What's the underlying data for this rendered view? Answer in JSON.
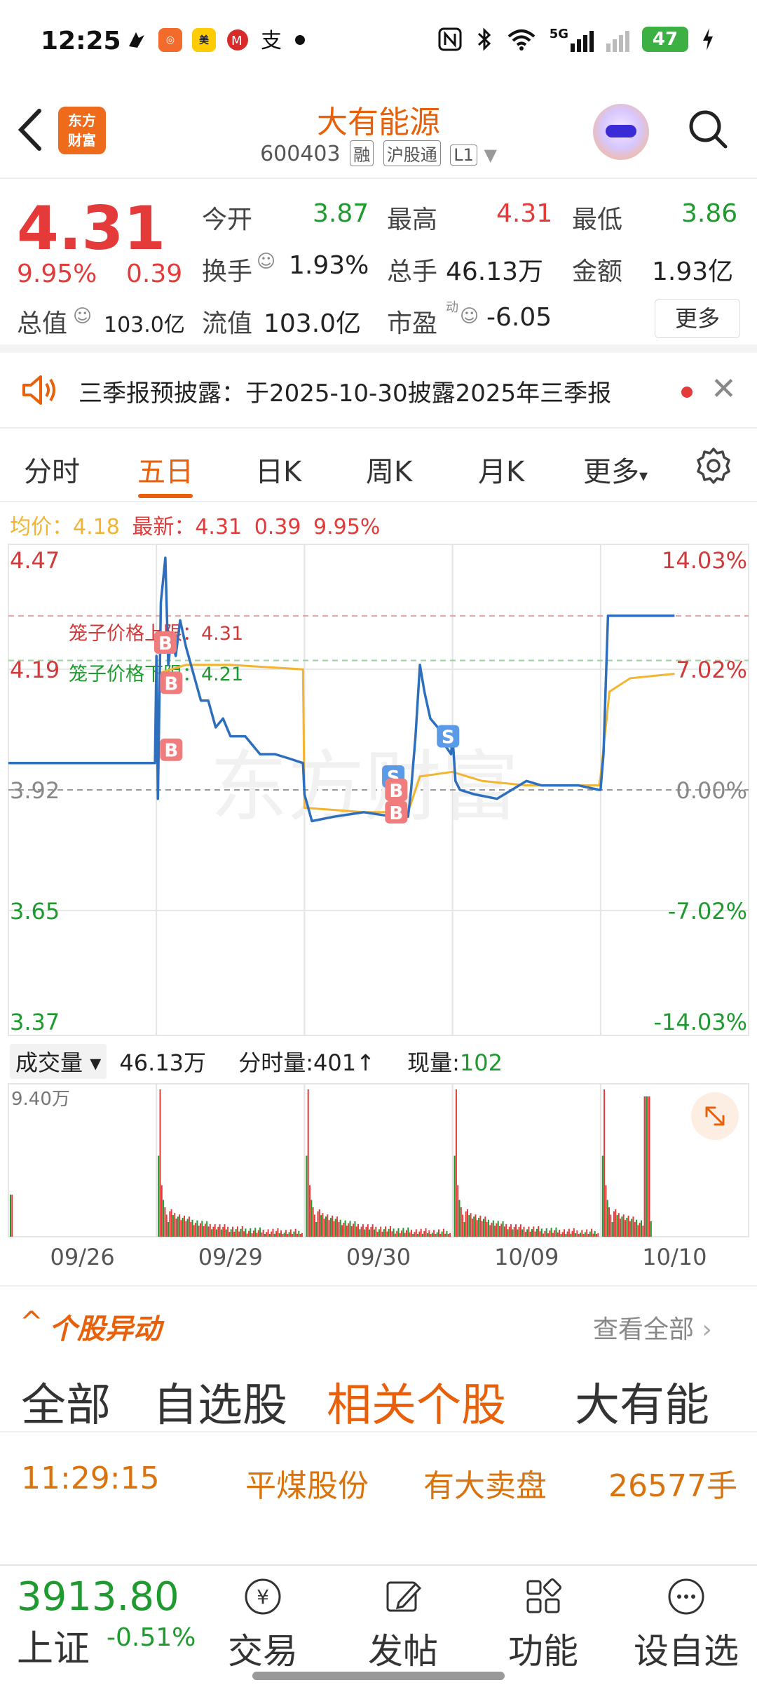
{
  "status_bar": {
    "time": "12:25",
    "battery": "47",
    "signal_label": "5G",
    "icons": [
      "notification-icon",
      "app-icon",
      "meituan-icon",
      "unionpay-icon",
      "alipay-icon",
      "dot-icon",
      "nfc-icon",
      "bluetooth-icon",
      "wifi-icon",
      "signal-icon",
      "battery-icon",
      "charging-icon"
    ]
  },
  "header": {
    "title": "大有能源",
    "code": "600403",
    "tags": [
      "融",
      "沪股通",
      "L1"
    ],
    "logo_line1": "东方",
    "logo_line2": "财富"
  },
  "quote": {
    "price": "4.31",
    "pct": "9.95%",
    "change": "0.39",
    "open_label": "今开",
    "open": "3.87",
    "high_label": "最高",
    "high": "4.31",
    "low_label": "最低",
    "low": "3.86",
    "turnover_label": "换手",
    "turnover": "1.93%",
    "volume_label": "总手",
    "volume": "46.13万",
    "amount_label": "金额",
    "amount": "1.93亿",
    "mktcap_label": "总值",
    "mktcap": "103.0亿",
    "float_label": "流值",
    "float": "103.0亿",
    "pe_label": "市盈",
    "pe_sup": "动",
    "pe": "-6.05",
    "more": "更多"
  },
  "notice": {
    "text": "三季报预披露：于2025-10-30披露2025年三季报"
  },
  "tabs": [
    "分时",
    "五日",
    "日K",
    "周K",
    "月K",
    "更多"
  ],
  "active_tab": "五日",
  "infoline": {
    "avg_label": "均价：",
    "avg": "4.18",
    "latest_label": "最新：",
    "latest": "4.31",
    "chg": "0.39",
    "pct": "9.95%"
  },
  "chart": {
    "y_left": [
      "4.47",
      "4.19",
      "3.92",
      "3.65",
      "3.37"
    ],
    "y_right": [
      "14.03%",
      "7.02%",
      "0.00%",
      "-7.02%",
      "-14.03%"
    ],
    "cage_upper_label": "笼子价格上限：4.31",
    "cage_lower_label": "笼子价格下限：4.21",
    "watermark": "东方财富",
    "markers": {
      "buy": "B",
      "sell": "S"
    }
  },
  "chart_data": {
    "type": "line",
    "title": "",
    "x_dates": [
      "09/26",
      "09/29",
      "09/30",
      "10/09",
      "10/10"
    ],
    "ylim": [
      3.37,
      4.47
    ],
    "prev_close": 3.92,
    "series": [
      {
        "name": "最新",
        "color": "#2e6fbd"
      },
      {
        "name": "均价",
        "color": "#f2b431"
      }
    ],
    "volume_max_label": "9.40万",
    "colors": {
      "price": "#2e6fbd",
      "avg": "#f2b431",
      "up": "#e43a3a",
      "down": "#1e9a2e"
    }
  },
  "volume_header": {
    "select": "成交量",
    "total": "46.13万",
    "tick_label": "分时量:",
    "tick": "401",
    "now_label": "现量:",
    "now": "102"
  },
  "section": {
    "title": "个股异动",
    "view_all": "查看全部",
    "sub_tabs": [
      "全部",
      "自选股",
      "相关个股",
      "大有能"
    ],
    "row": {
      "time": "11:29:15",
      "name": "平煤股份",
      "event": "有大卖盘",
      "qty": "26577手"
    }
  },
  "bottom_bar": {
    "index_value": "3913.80",
    "index_name": "上证",
    "index_pct": "-0.51%",
    "items": [
      "交易",
      "发帖",
      "功能",
      "设自选"
    ]
  }
}
